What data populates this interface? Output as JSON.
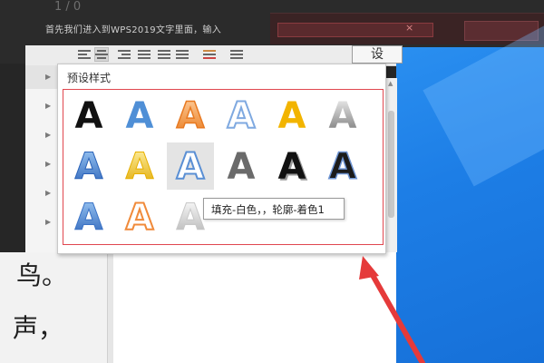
{
  "background": {
    "doc_text_top": "首先我们进入到WPS2019文字里面，输入",
    "doc_line_numbers": "1 / 0",
    "set_button_label": "设"
  },
  "panel": {
    "title": "预设样式",
    "styles": [
      {
        "row": 0,
        "col": 0,
        "name": "黑色填充",
        "kind": "black"
      },
      {
        "row": 0,
        "col": 1,
        "name": "蓝色填充",
        "kind": "blue"
      },
      {
        "row": 0,
        "col": 2,
        "name": "橙色填充",
        "kind": "orange"
      },
      {
        "row": 0,
        "col": 3,
        "name": "白色填充蓝色轮廓",
        "kind": "outline-blue-light"
      },
      {
        "row": 0,
        "col": 4,
        "name": "金色填充",
        "kind": "gold"
      },
      {
        "row": 0,
        "col": 5,
        "name": "灰色渐变",
        "kind": "gray-gradient"
      },
      {
        "row": 1,
        "col": 0,
        "name": "蓝色渐变阴影",
        "kind": "blue-gradient"
      },
      {
        "row": 1,
        "col": 1,
        "name": "金色渐变",
        "kind": "gold-gradient"
      },
      {
        "row": 1,
        "col": 2,
        "name": "填充-白色，轮廓-着色1",
        "kind": "outline-blue",
        "highlighted": true
      },
      {
        "row": 1,
        "col": 3,
        "name": "灰色填充",
        "kind": "gray"
      },
      {
        "row": 1,
        "col": 4,
        "name": "黑色阴影",
        "kind": "black-shadow"
      },
      {
        "row": 1,
        "col": 5,
        "name": "黑色蓝色轮廓",
        "kind": "black-blue"
      },
      {
        "row": 2,
        "col": 0,
        "name": "蓝色立体",
        "kind": "blue-3d"
      },
      {
        "row": 2,
        "col": 1,
        "name": "橙色轮廓",
        "kind": "outline-orange"
      },
      {
        "row": 2,
        "col": 2,
        "name": "银色渐变",
        "kind": "silver"
      }
    ]
  },
  "tooltip": {
    "text": "填充-白色，，轮廓-着色1"
  },
  "document": {
    "line1": "鸟。",
    "line2": "声，"
  },
  "colors": {
    "frame": "#e0474f",
    "arrow": "#e53a3a",
    "desktop": "#1d7ee6"
  }
}
